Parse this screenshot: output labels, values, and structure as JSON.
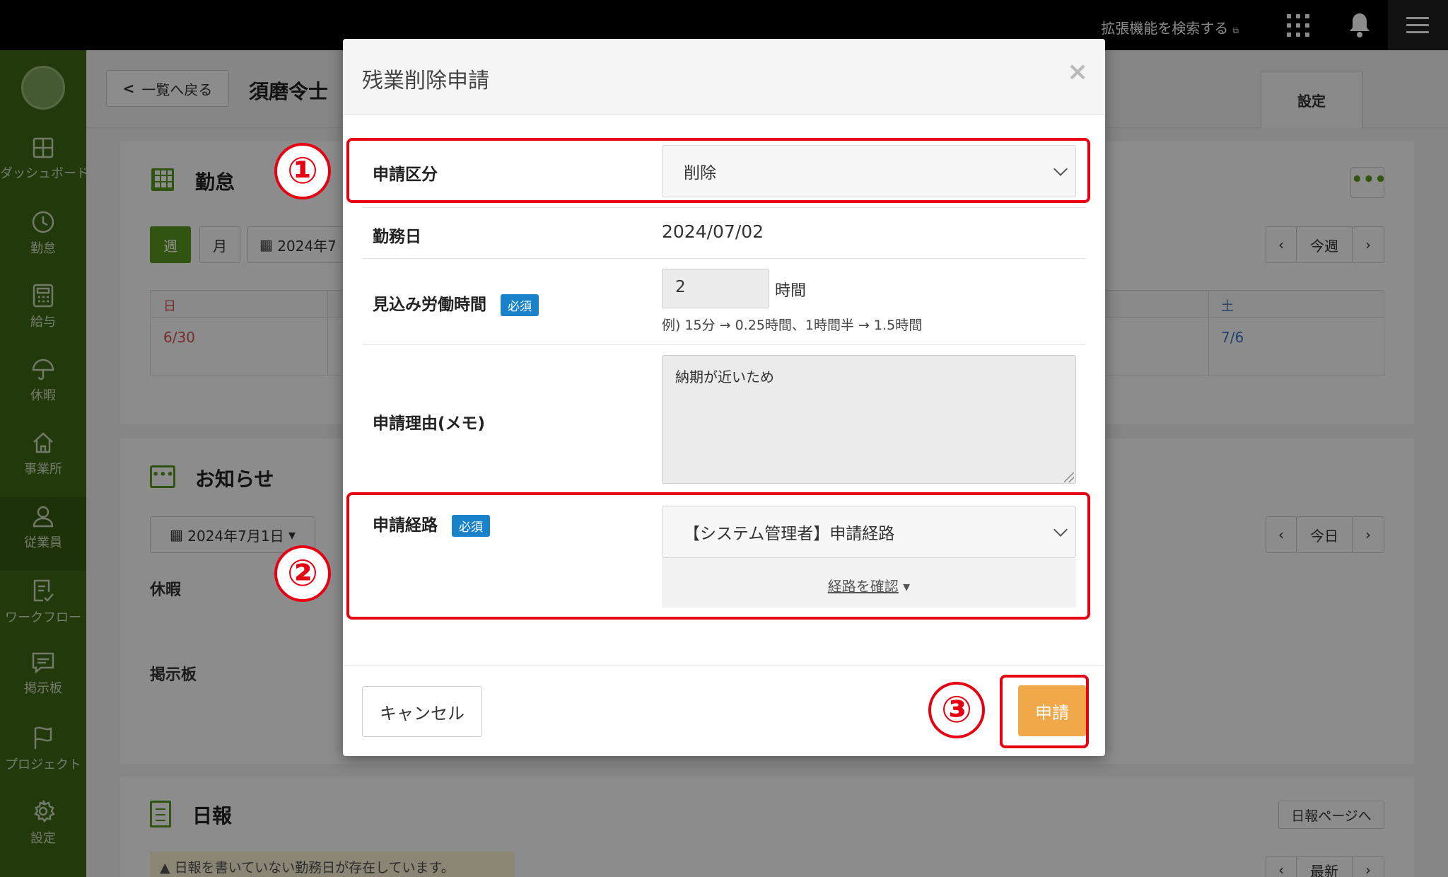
{
  "topbar": {
    "ext_search_label": "拡張機能を検索する",
    "ext_icon": "external-link-icon",
    "apps_icon": "grid-icon",
    "bell_icon": "bell-icon",
    "menu_icon": "hamburger-icon"
  },
  "sidebar": {
    "items": [
      {
        "label": "ダッシュボード",
        "icon": "dashboard-icon"
      },
      {
        "label": "勤怠",
        "icon": "clock-icon"
      },
      {
        "label": "給与",
        "icon": "calculator-icon"
      },
      {
        "label": "休暇",
        "icon": "umbrella-icon"
      },
      {
        "label": "事業所",
        "icon": "home-icon"
      },
      {
        "label": "従業員",
        "icon": "user-icon"
      },
      {
        "label": "ワークフロー",
        "icon": "checklist-icon"
      },
      {
        "label": "掲示板",
        "icon": "chat-icon"
      },
      {
        "label": "プロジェクト",
        "icon": "flag-icon"
      },
      {
        "label": "設定",
        "icon": "gear-icon"
      }
    ]
  },
  "header": {
    "back_label": "一覧へ戻る",
    "employee_name": "須磨令士",
    "settings_tab": "設定"
  },
  "attendance": {
    "title": "勤怠",
    "week_btn": "週",
    "month_btn": "月",
    "date_btn": "2024年7",
    "this_week": "今週",
    "prev": "‹",
    "next": "›",
    "day_sun": "日",
    "day_sat": "土",
    "date_sun": "6/30",
    "date_sat": "7/6"
  },
  "notices": {
    "title": "お知らせ",
    "date_btn": "2024年7月1日",
    "today": "今日",
    "leave_label": "休暇",
    "board_label": "掲示板"
  },
  "daily_report": {
    "title": "日報",
    "page_link": "日報ページへ",
    "latest": "最新",
    "warning": "日報を書いていない勤務日が存在しています。"
  },
  "modal": {
    "title": "残業削除申請",
    "close": "×",
    "type_label": "申請区分",
    "type_value": "削除",
    "workday_label": "勤務日",
    "workday_value": "2024/07/02",
    "hours_label": "見込み労働時間",
    "required": "必須",
    "hours_value": "2",
    "hours_unit": "時間",
    "hours_hint": "例) 15分 → 0.25時間、1時間半 → 1.5時間",
    "reason_label": "申請理由(メモ)",
    "reason_value": "納期が近いため",
    "route_label": "申請経路",
    "route_value": "【システム管理者】申請経路",
    "route_check": "経路を確認",
    "cancel": "キャンセル",
    "submit": "申請"
  },
  "annotations": {
    "step1": "①",
    "step2": "②",
    "step3": "③"
  },
  "colors": {
    "sidebar": "#3f6b14",
    "accent_green": "#5a9a1e",
    "highlight_red": "#e60012",
    "submit_orange": "#f0a848",
    "required_blue": "#1a82c9"
  }
}
